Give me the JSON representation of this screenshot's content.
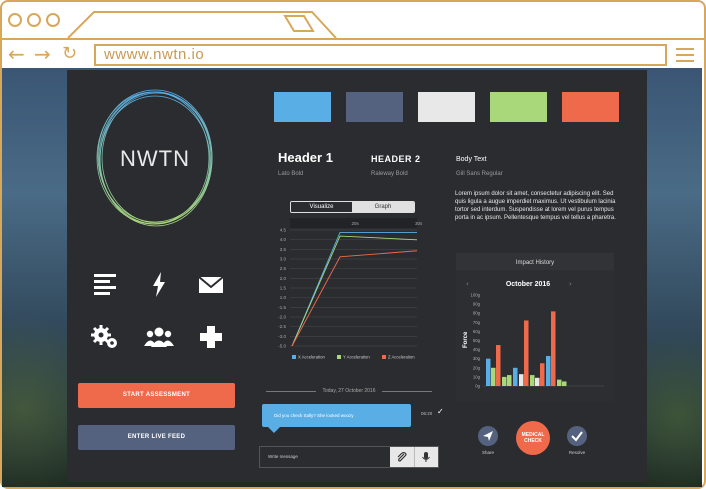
{
  "browser": {
    "url": "wwww.nwtn.io",
    "back_icon": "arrow-left",
    "forward_icon": "arrow-right",
    "reload_icon": "reload",
    "menu_icon": "hamburger"
  },
  "logo": {
    "text": "NWTN"
  },
  "icons": [
    "list-icon",
    "lightning-icon",
    "mail-icon",
    "gears-icon",
    "users-icon",
    "plus-icon"
  ],
  "buttons": {
    "start": "START ASSESSMENT",
    "live": "ENTER LIVE FEED"
  },
  "palette": [
    "#5aaee6",
    "#55627f",
    "#e8e8e8",
    "#a9d87b",
    "#ef6a4b"
  ],
  "typography": {
    "h1": {
      "label": "Header 1",
      "font": "Lato Bold"
    },
    "h2": {
      "label": "HEADER 2",
      "font": "Raleway Bold"
    },
    "body": {
      "label": "Body Text",
      "font": "Gill Sans Regular"
    },
    "lorem": "Lorem ipsum dolor sit amet, consectetur adipiscing elit. Sed quis ligula a augue imperdiet maximus. Ut vestibulum lacinia tortor sed interdum. Suspendisse at lorem vel purus tempus porta in ac ipsum. Pellentesque tempus vel tellus a pharetra."
  },
  "toggle": {
    "a": "Visualize",
    "b": "Graph"
  },
  "chart_data": [
    {
      "type": "line",
      "x": [
        "",
        "20s",
        "30s"
      ],
      "ylim": [
        -5.0,
        4.5
      ],
      "yticks": [
        "4.5",
        "4.0",
        "3.5",
        "3.0",
        "2.5",
        "2.0",
        "1.5",
        "1.0",
        "-1.5",
        "-2.0",
        "-2.5",
        "-3.0",
        "-5.0"
      ],
      "series": [
        {
          "name": "X Acceleration",
          "color": "#5aaee6",
          "values": [
            -5.0,
            4.3,
            4.3
          ]
        },
        {
          "name": "Y Acceleration",
          "color": "#a9d87b",
          "values": [
            -5.0,
            4.0,
            3.7
          ]
        },
        {
          "name": "Z Acceleration",
          "color": "#ef6a4b",
          "values": [
            -5.0,
            2.3,
            2.8
          ]
        }
      ],
      "legend": "bottom"
    },
    {
      "type": "bar",
      "title": "Impact History",
      "month": "October 2016",
      "ylabel": "Force",
      "yticks": [
        "100g",
        "90g",
        "80g",
        "70g",
        "60g",
        "50g",
        "40g",
        "30g",
        "20g",
        "10g",
        "0g"
      ],
      "ylim": [
        0,
        100
      ],
      "bars": [
        {
          "value": 30,
          "color": "#5aaee6"
        },
        {
          "value": 20,
          "color": "#a9d87b"
        },
        {
          "value": 45,
          "color": "#ef6a4b"
        },
        {
          "value": 10,
          "color": "#a9d87b"
        },
        {
          "value": 12,
          "color": "#a9d87b"
        },
        {
          "value": 20,
          "color": "#5aaee6"
        },
        {
          "value": 13,
          "color": "#e8e8e8"
        },
        {
          "value": 72,
          "color": "#ef6a4b"
        },
        {
          "value": 12,
          "color": "#a9d87b"
        },
        {
          "value": 9,
          "color": "#e8e8e8"
        },
        {
          "value": 25,
          "color": "#ef6a4b"
        },
        {
          "value": 33,
          "color": "#5aaee6"
        },
        {
          "value": 82,
          "color": "#ef6a4b"
        },
        {
          "value": 7,
          "color": "#a9d87b"
        },
        {
          "value": 5,
          "color": "#a9d87b"
        }
      ]
    }
  ],
  "chat": {
    "date": "Today, 27 October 2016",
    "message": "Did you check Sally? She looked woozy",
    "time": "06:20",
    "placeholder": "Write message"
  },
  "actions": {
    "share": "Share",
    "medical_line1": "MEDICAL",
    "medical_line2": "CHECK",
    "resolve": "Resolve"
  }
}
